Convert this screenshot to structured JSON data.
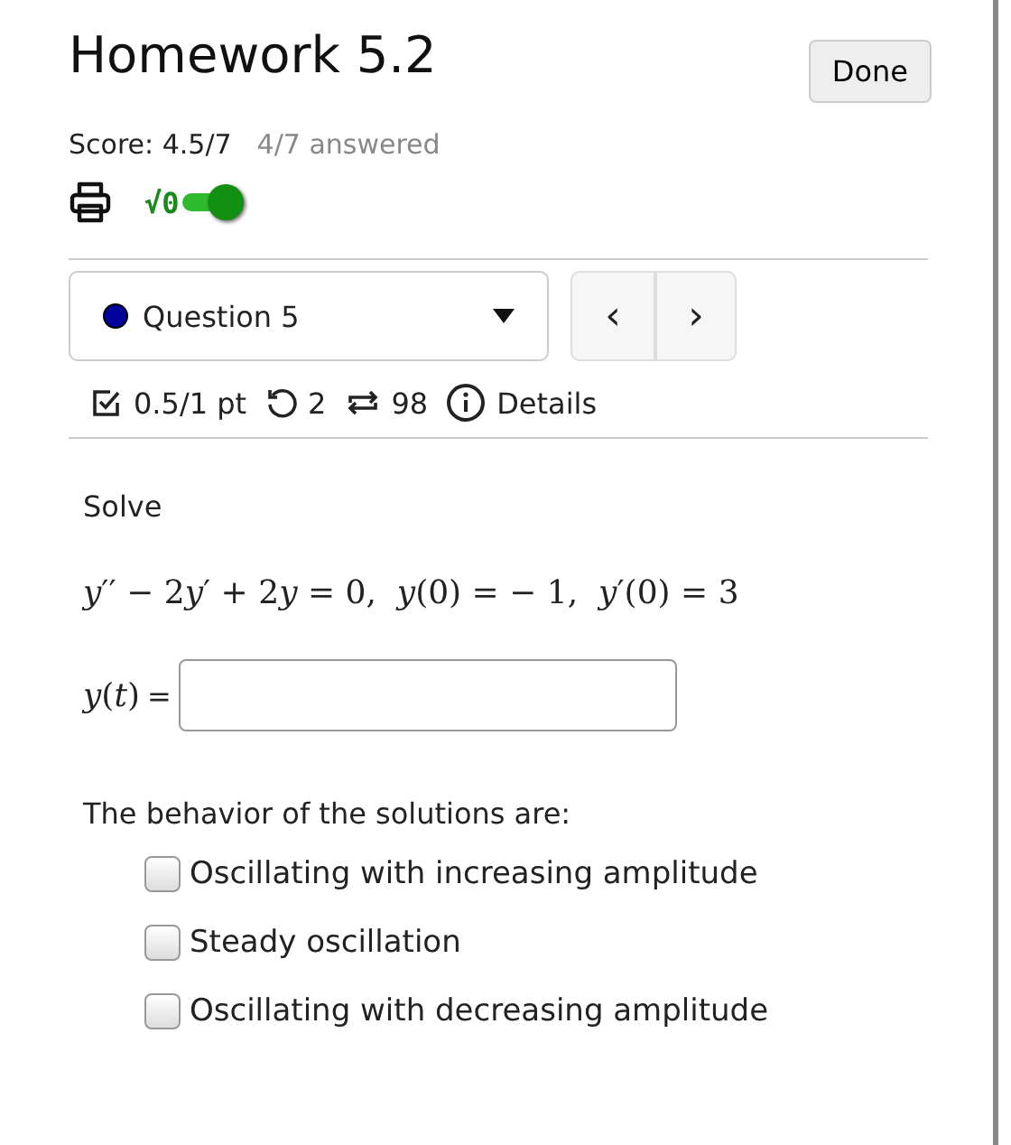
{
  "header": {
    "title": "Homework 5.2",
    "done_button": "Done",
    "score": "Score: 4.5/7",
    "answered": "4/7 answered",
    "math_toggle": {
      "symbol": "√0",
      "on": true
    }
  },
  "question_nav": {
    "label": "Question 5",
    "color": "#00009c",
    "prev": "‹",
    "next": "›"
  },
  "meta": {
    "points": "0.5/1 pt",
    "retries": "2",
    "attempts": "98",
    "details": "Details"
  },
  "question": {
    "prompt": "Solve",
    "equation": [
      {
        "kind": "var",
        "text": "y"
      },
      {
        "kind": "num",
        "text": "′′ − 2"
      },
      {
        "kind": "var",
        "text": "y"
      },
      {
        "kind": "num",
        "text": "′ + 2"
      },
      {
        "kind": "var",
        "text": "y"
      },
      {
        "kind": "num",
        "text": " = 0,  "
      },
      {
        "kind": "var",
        "text": "y"
      },
      {
        "kind": "num",
        "text": "(0) = − 1,  "
      },
      {
        "kind": "var",
        "text": "y"
      },
      {
        "kind": "num",
        "text": "′(0) = 3"
      }
    ],
    "answer_label": "*y*(*t*)",
    "answer_eq": "=",
    "behavior_prompt": "The behavior of the solutions are:",
    "options": [
      {
        "label": "Oscillating with increasing amplitude",
        "checked": false
      },
      {
        "label": "Steady oscillation",
        "checked": false
      },
      {
        "label": "Oscillating with decreasing amplitude",
        "checked": false
      }
    ]
  }
}
